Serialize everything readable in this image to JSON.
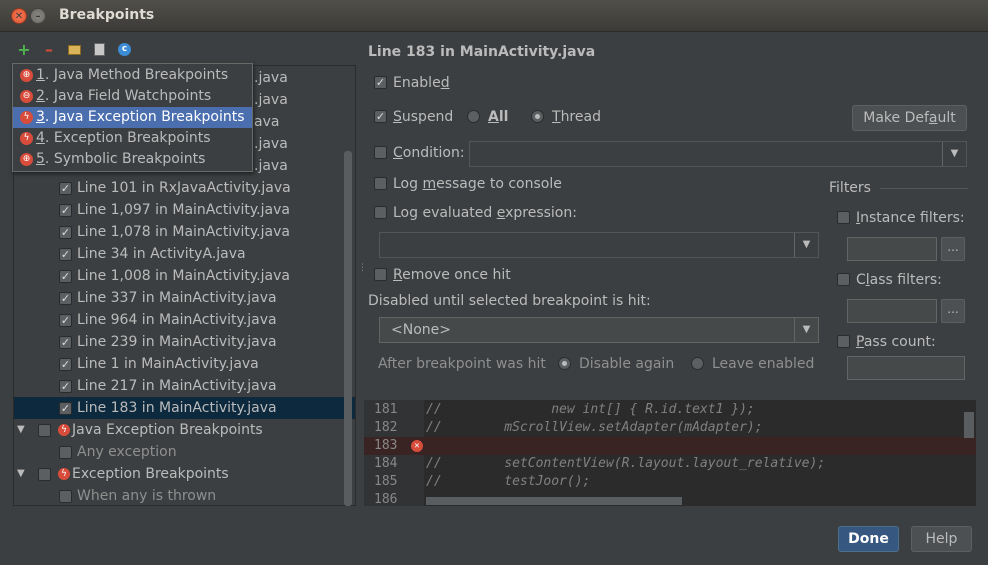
{
  "window": {
    "title": "Breakpoints"
  },
  "toolbar": {
    "add_icon": "plus-icon",
    "remove_icon": "minus-icon",
    "group_icon": "folder-icon",
    "doc_icon": "document-icon",
    "class_icon": "class-icon"
  },
  "popup_menu": {
    "items": [
      {
        "num": "1",
        "label": ". Java Method Breakpoints",
        "selected": false
      },
      {
        "num": "2",
        "label": ". Java Field Watchpoints",
        "selected": false
      },
      {
        "num": "3",
        "label": ". Java Exception Breakpoints",
        "selected": true
      },
      {
        "num": "4",
        "label": ". Exception Breakpoints",
        "selected": false
      },
      {
        "num": "5",
        "label": ". Symbolic Breakpoints",
        "selected": false
      }
    ]
  },
  "tree": {
    "hidden_suffixes": [
      ".java",
      ".java",
      "ava",
      ".java",
      ".java"
    ],
    "lines": [
      "Line 101 in RxJavaActivity.java",
      "Line 1,097 in MainActivity.java",
      "Line 1,078 in MainActivity.java",
      "Line 34 in ActivityA.java",
      "Line 1,008 in MainActivity.java",
      "Line 337 in MainActivity.java",
      "Line 964 in MainActivity.java",
      "Line 239 in MainActivity.java",
      "Line 1 in MainActivity.java",
      "Line 217 in MainActivity.java",
      "Line 183 in MainActivity.java"
    ],
    "group_java_exception": "Java Exception Breakpoints",
    "any_exception": "Any exception",
    "group_exception": "Exception Breakpoints",
    "when_any_thrown": "When any is thrown"
  },
  "details": {
    "title": "Line 183 in MainActivity.java",
    "enabled": {
      "pre": "Enable",
      "ul": "d",
      "post": "",
      "checked": true
    },
    "suspend": {
      "pre": "",
      "ul": "S",
      "post": "uspend",
      "checked": true
    },
    "all": {
      "ul": "A",
      "post": "ll"
    },
    "thread": {
      "ul": "T",
      "post": "hread"
    },
    "make_default": {
      "pre": "Make Def",
      "ul": "a",
      "post": "ult"
    },
    "condition": {
      "ul": "C",
      "post": "ondition:"
    },
    "log_message": {
      "pre": "Log ",
      "ul": "m",
      "post": "essage to console"
    },
    "log_expression": {
      "pre": "Log evaluated ",
      "ul": "e",
      "post": "xpression:"
    },
    "remove_once_hit": {
      "ul": "R",
      "post": "emove once hit"
    },
    "disabled_until": "Disabled until selected breakpoint is hit:",
    "none_option": "<None>",
    "after_hit": "After breakpoint was hit",
    "disable_again": "Disable again",
    "leave_enabled": "Leave enabled"
  },
  "filters": {
    "title": "Filters",
    "instance": {
      "ul": "I",
      "post": "nstance filters:"
    },
    "class": {
      "pre": "C",
      "ul": "l",
      "post": "ass filters:"
    },
    "pass_count": {
      "ul": "P",
      "post": "ass count:"
    },
    "browse": "..."
  },
  "editor": {
    "lines": [
      {
        "num": "181",
        "code": "//              new int[] { R.id.text1 });"
      },
      {
        "num": "182",
        "code": "//        mScrollView.setAdapter(mAdapter);"
      },
      {
        "num": "183",
        "code": ""
      },
      {
        "num": "184",
        "code": "//        setContentView(R.layout.layout_relative);"
      },
      {
        "num": "185",
        "code": "//        testJoor();"
      },
      {
        "num": "186",
        "code": ""
      }
    ]
  },
  "footer": {
    "done": "Done",
    "help": "Help"
  },
  "colors": {
    "accent": "#4b6eaf",
    "breakpoint": "#d84c3c",
    "selection": "#0d293e"
  }
}
